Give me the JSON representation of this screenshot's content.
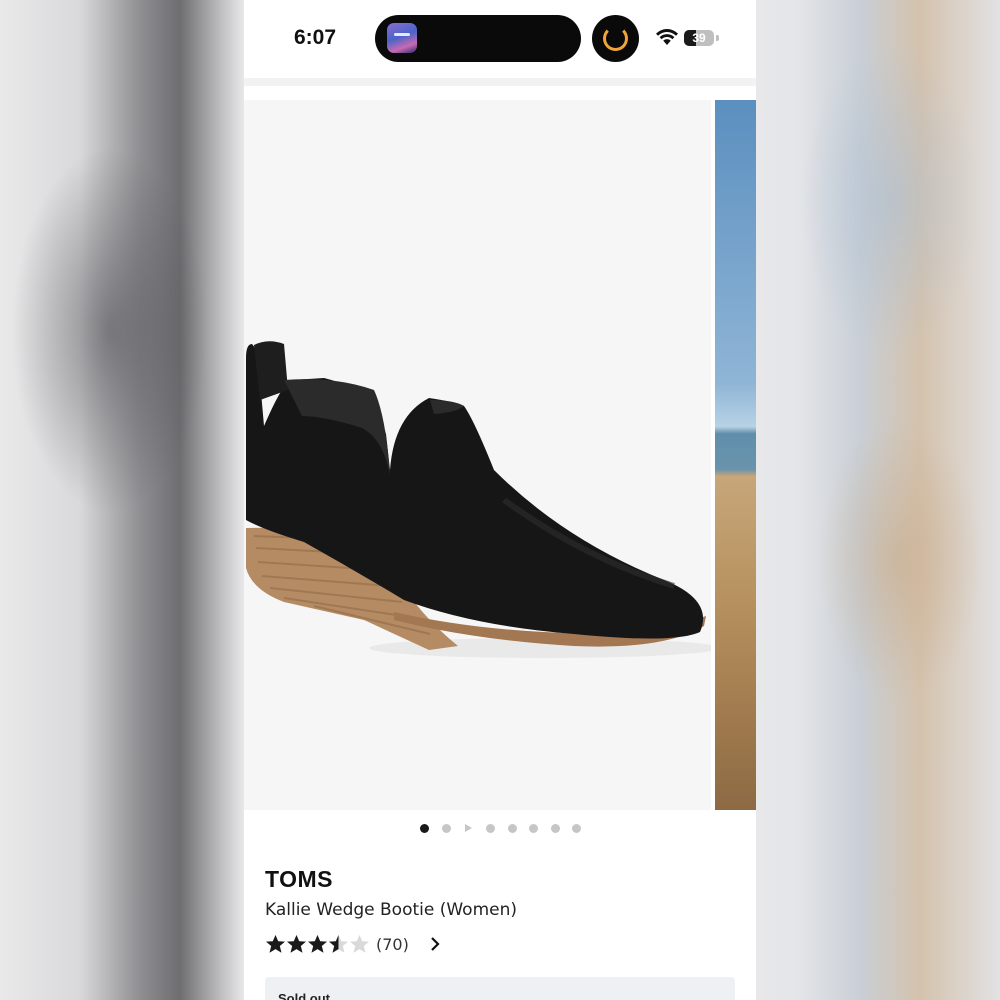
{
  "status_bar": {
    "time": "6:07",
    "battery_level": "39",
    "battery_fraction": 0.39,
    "icons": [
      "now-playing-thumbnail-icon",
      "timer-icon",
      "wifi-icon",
      "battery-icon"
    ],
    "timer_color": "#f0a637"
  },
  "gallery": {
    "image_count": 8,
    "active_index": 0,
    "video_index": 2
  },
  "product": {
    "brand": "TOMS",
    "name": "Kallie Wedge Bootie (Women)",
    "rating": 3.5,
    "rating_max": 5,
    "review_count": "(70)",
    "availability": "Sold out"
  },
  "colors": {
    "star_filled": "#1a1a1a",
    "star_empty": "#d9d9d9",
    "sold_box_bg": "#edf1f4"
  }
}
